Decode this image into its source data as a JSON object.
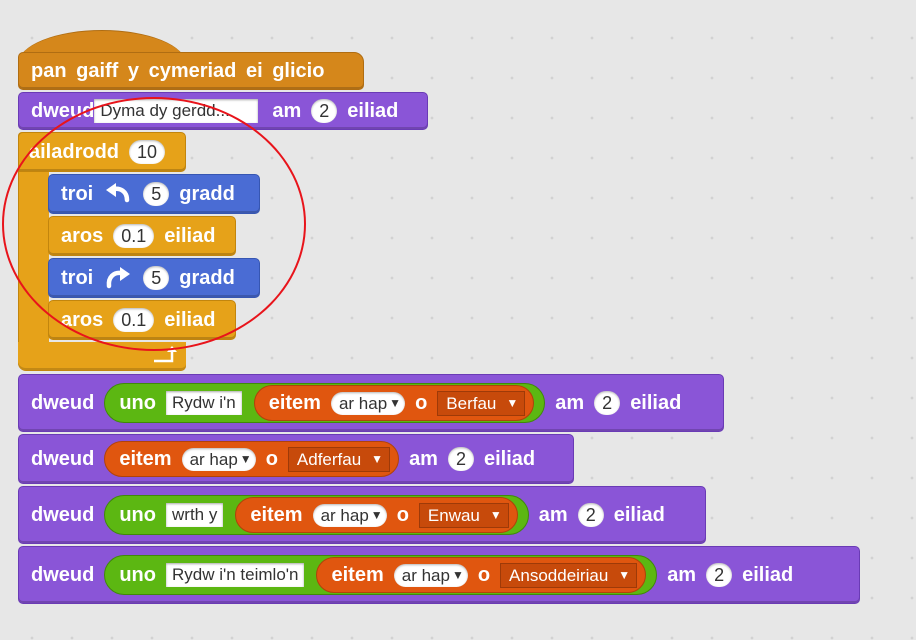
{
  "hat": {
    "text": "pan gaiff y cymeriad ei glicio"
  },
  "say_intro": {
    "verb": "dweud",
    "message": "Dyma dy gerdd...",
    "for": "am",
    "secs": "2",
    "unit": "eiliad"
  },
  "repeat": {
    "label": "ailadrodd",
    "count": "10",
    "body": [
      {
        "kind": "turn",
        "verb": "troi",
        "icon": "turn-left-icon",
        "degrees": "5",
        "unit": "gradd"
      },
      {
        "kind": "wait",
        "verb": "aros",
        "secs": "0.1",
        "unit": "eiliad"
      },
      {
        "kind": "turn",
        "verb": "troi",
        "icon": "turn-right-icon",
        "degrees": "5",
        "unit": "gradd"
      },
      {
        "kind": "wait",
        "verb": "aros",
        "secs": "0.1",
        "unit": "eiliad"
      }
    ]
  },
  "say_blocks": [
    {
      "verb": "dweud",
      "join": "uno",
      "text": "Rydw i'n",
      "item": "eitem",
      "pick": "ar hap",
      "of": "o",
      "list": "Berfau",
      "for": "am",
      "secs": "2",
      "unit": "eiliad"
    },
    {
      "verb": "dweud",
      "item": "eitem",
      "pick": "ar hap",
      "of": "o",
      "list": "Adferfau",
      "for": "am",
      "secs": "2",
      "unit": "eiliad"
    },
    {
      "verb": "dweud",
      "join": "uno",
      "text": "wrth y",
      "item": "eitem",
      "pick": "ar hap",
      "of": "o",
      "list": "Enwau",
      "for": "am",
      "secs": "2",
      "unit": "eiliad"
    },
    {
      "verb": "dweud",
      "join": "uno",
      "text": "Rydw i'n teimlo'n",
      "item": "eitem",
      "pick": "ar hap",
      "of": "o",
      "list": "Ansoddeiriau",
      "for": "am",
      "secs": "2",
      "unit": "eiliad"
    }
  ],
  "colors": {
    "events": "#d5871b",
    "looks": "#8a55d7",
    "control": "#e6a219",
    "motion": "#4a6cd4",
    "operators": "#5cb712",
    "lists": "#e0560f",
    "annotation": "#e8141b"
  }
}
